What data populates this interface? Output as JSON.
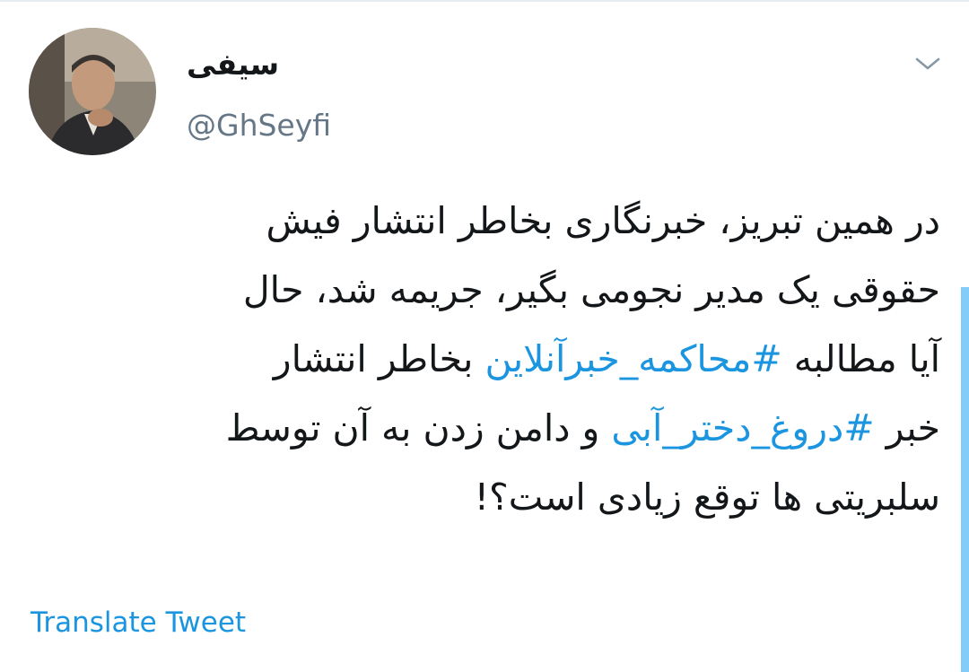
{
  "author": {
    "display_name": "سیفی",
    "handle": "@GhSeyfi"
  },
  "tweet": {
    "line1": "در همین تبریز، خبرنگاری بخاطر انتشار فیش",
    "line2": "حقوقی یک مدیر نجومی بگیر، جریمه شد، حال",
    "line3_before": "آیا مطالبه ",
    "hashtag1": "#محاکمه_خبرآنلاین",
    "line3_after": " بخاطر انتشار",
    "line4_before": "خبر ",
    "hashtag2": "#دروغ_دختر_آبی",
    "line4_after": " و دامن زدن به آن توسط",
    "line5": "سلبریتی ها توقع زیادی است؟!"
  },
  "translate_label": "Translate Tweet",
  "colors": {
    "link": "#1b95e0",
    "text": "#14171a",
    "secondary": "#657786"
  },
  "icons": {
    "menu": "chevron-down-icon",
    "avatar": "avatar"
  }
}
